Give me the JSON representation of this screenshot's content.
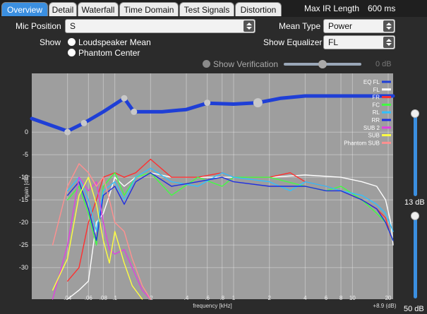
{
  "tabs": [
    {
      "label": "Overview",
      "active": true
    },
    {
      "label": "Detail"
    },
    {
      "label": "Waterfall"
    },
    {
      "label": "Time Domain"
    },
    {
      "label": "Test Signals"
    },
    {
      "label": "Distortion"
    }
  ],
  "max_ir": {
    "label": "Max IR Length",
    "value": "600 ms"
  },
  "mic_position": {
    "label": "Mic Position",
    "value": "S"
  },
  "show": {
    "label": "Show",
    "options": [
      "Loudspeaker Mean",
      "Phantom Center"
    ]
  },
  "mean_type": {
    "label": "Mean Type",
    "value": "Power"
  },
  "show_equalizer": {
    "label": "Show Equalizer",
    "value": "FL"
  },
  "verification": {
    "label": "Show Verification",
    "value": "0 dB",
    "level": 0.5
  },
  "sliders": {
    "upper": "13 dB",
    "lower": "50 dB"
  },
  "chart_data": {
    "type": "line",
    "title": "",
    "xlabel": "frequency [kHz]",
    "ylabel": "gain [dB]",
    "x_scale": "log",
    "xlim": [
      0.02,
      22
    ],
    "ylim": [
      -37,
      13
    ],
    "x_ticks": [
      {
        "v": 0.04,
        "label": ".04"
      },
      {
        "v": 0.06,
        "label": ".06"
      },
      {
        "v": 0.08,
        "label": ".08"
      },
      {
        "v": 0.1,
        "label": ".1"
      },
      {
        "v": 0.2,
        "label": ".2"
      },
      {
        "v": 0.4,
        "label": ".4"
      },
      {
        "v": 0.6,
        "label": ".6"
      },
      {
        "v": 0.8,
        "label": ".8"
      },
      {
        "v": 1,
        "label": "1"
      },
      {
        "v": 2,
        "label": "2"
      },
      {
        "v": 4,
        "label": "4"
      },
      {
        "v": 6,
        "label": "6"
      },
      {
        "v": 8,
        "label": "8"
      },
      {
        "v": 10,
        "label": "10"
      },
      {
        "v": 20,
        "label": "20"
      }
    ],
    "x_corner_label": "+8.9 (dB)",
    "y_ticks": [
      0,
      -5,
      -10,
      -15,
      -20,
      -25,
      -30
    ],
    "legend_placement": "top-right",
    "eq_points": [
      {
        "f": 0.04,
        "db": 0,
        "big": false
      },
      {
        "f": 0.055,
        "db": 2,
        "big": false
      },
      {
        "f": 0.12,
        "db": 7.5,
        "big": false
      },
      {
        "f": 0.145,
        "db": 4.5,
        "big": false
      },
      {
        "f": 0.6,
        "db": 6.5,
        "big": false
      },
      {
        "f": 1.6,
        "db": 6.5,
        "big": true
      }
    ],
    "series": [
      {
        "name": "EQ FL",
        "color": "#1f3fd6",
        "points": [
          [
            0.02,
            3
          ],
          [
            0.04,
            0.2
          ],
          [
            0.055,
            2
          ],
          [
            0.08,
            4.5
          ],
          [
            0.12,
            7.5
          ],
          [
            0.145,
            4.5
          ],
          [
            0.25,
            4.5
          ],
          [
            0.4,
            5
          ],
          [
            0.6,
            6.4
          ],
          [
            1,
            6.2
          ],
          [
            1.6,
            6.5
          ],
          [
            2.5,
            7.5
          ],
          [
            4,
            8
          ],
          [
            10,
            8
          ],
          [
            22,
            8
          ]
        ]
      },
      {
        "name": "FL",
        "color": "#ffffff",
        "points": [
          [
            0.04,
            -37
          ],
          [
            0.05,
            -35
          ],
          [
            0.06,
            -33
          ],
          [
            0.07,
            -20
          ],
          [
            0.08,
            -18
          ],
          [
            0.09,
            -14
          ],
          [
            0.1,
            -10
          ],
          [
            0.12,
            -12
          ],
          [
            0.15,
            -10
          ],
          [
            0.2,
            -9
          ],
          [
            0.3,
            -10
          ],
          [
            0.5,
            -10
          ],
          [
            1,
            -10
          ],
          [
            2,
            -10
          ],
          [
            4,
            -9.5
          ],
          [
            8,
            -10
          ],
          [
            12,
            -11
          ],
          [
            16,
            -12
          ],
          [
            19,
            -15
          ],
          [
            21,
            -20
          ],
          [
            22,
            -25
          ]
        ]
      },
      {
        "name": "FR",
        "color": "#ff3030",
        "points": [
          [
            0.04,
            -33
          ],
          [
            0.05,
            -30
          ],
          [
            0.06,
            -20
          ],
          [
            0.07,
            -15
          ],
          [
            0.08,
            -10
          ],
          [
            0.1,
            -9
          ],
          [
            0.12,
            -10
          ],
          [
            0.15,
            -9
          ],
          [
            0.2,
            -6
          ],
          [
            0.3,
            -10
          ],
          [
            0.5,
            -10
          ],
          [
            0.8,
            -9
          ],
          [
            1,
            -10
          ],
          [
            2,
            -10
          ],
          [
            3,
            -9
          ],
          [
            4,
            -11
          ],
          [
            6,
            -12
          ],
          [
            8,
            -13
          ],
          [
            12,
            -15
          ],
          [
            16,
            -17
          ],
          [
            19,
            -19
          ],
          [
            21,
            -23
          ]
        ]
      },
      {
        "name": "FC",
        "color": "#40ff40",
        "points": [
          [
            0.04,
            -15
          ],
          [
            0.05,
            -12
          ],
          [
            0.06,
            -18
          ],
          [
            0.07,
            -25
          ],
          [
            0.08,
            -12
          ],
          [
            0.1,
            -9
          ],
          [
            0.12,
            -14
          ],
          [
            0.15,
            -10
          ],
          [
            0.2,
            -9
          ],
          [
            0.3,
            -14
          ],
          [
            0.5,
            -10
          ],
          [
            0.8,
            -12
          ],
          [
            1,
            -10
          ],
          [
            2,
            -10
          ],
          [
            4,
            -12
          ],
          [
            6,
            -13
          ],
          [
            8,
            -12
          ],
          [
            12,
            -15
          ],
          [
            16,
            -18
          ],
          [
            19,
            -20
          ],
          [
            22,
            -24
          ]
        ]
      },
      {
        "name": "RL",
        "color": "#30c0ff",
        "points": [
          [
            0.04,
            -13
          ],
          [
            0.05,
            -10
          ],
          [
            0.06,
            -15
          ],
          [
            0.07,
            -22
          ],
          [
            0.08,
            -13
          ],
          [
            0.1,
            -11
          ],
          [
            0.12,
            -15
          ],
          [
            0.15,
            -10
          ],
          [
            0.2,
            -8
          ],
          [
            0.3,
            -11
          ],
          [
            0.5,
            -12
          ],
          [
            0.8,
            -9
          ],
          [
            1,
            -10
          ],
          [
            2,
            -11
          ],
          [
            3,
            -13
          ],
          [
            4,
            -11
          ],
          [
            6,
            -12
          ],
          [
            8,
            -13
          ],
          [
            12,
            -14
          ],
          [
            16,
            -16
          ],
          [
            19,
            -18
          ],
          [
            22,
            -22
          ]
        ]
      },
      {
        "name": "RR",
        "color": "#1f2fe0",
        "points": [
          [
            0.04,
            -14
          ],
          [
            0.05,
            -11
          ],
          [
            0.06,
            -17
          ],
          [
            0.07,
            -24
          ],
          [
            0.08,
            -14
          ],
          [
            0.1,
            -12
          ],
          [
            0.12,
            -16
          ],
          [
            0.15,
            -11
          ],
          [
            0.2,
            -9
          ],
          [
            0.3,
            -12
          ],
          [
            0.5,
            -11
          ],
          [
            0.8,
            -10
          ],
          [
            1,
            -11
          ],
          [
            2,
            -12
          ],
          [
            4,
            -12
          ],
          [
            6,
            -13
          ],
          [
            8,
            -13
          ],
          [
            12,
            -15
          ],
          [
            16,
            -17
          ],
          [
            19,
            -20
          ],
          [
            22,
            -24
          ]
        ]
      },
      {
        "name": "SUB 2",
        "color": "#e040e0",
        "points": [
          [
            0.03,
            -37
          ],
          [
            0.04,
            -25
          ],
          [
            0.05,
            -10
          ],
          [
            0.06,
            -13
          ],
          [
            0.07,
            -11
          ],
          [
            0.08,
            -20
          ],
          [
            0.09,
            -26
          ],
          [
            0.1,
            -27
          ],
          [
            0.12,
            -26
          ],
          [
            0.14,
            -30
          ],
          [
            0.17,
            -35
          ],
          [
            0.2,
            -37
          ]
        ]
      },
      {
        "name": "SUB",
        "color": "#ffff40",
        "points": [
          [
            0.03,
            -35
          ],
          [
            0.04,
            -28
          ],
          [
            0.05,
            -14
          ],
          [
            0.06,
            -10
          ],
          [
            0.07,
            -16
          ],
          [
            0.08,
            -24
          ],
          [
            0.09,
            -29
          ],
          [
            0.1,
            -22
          ],
          [
            0.12,
            -29
          ],
          [
            0.14,
            -34
          ],
          [
            0.17,
            -37
          ]
        ]
      },
      {
        "name": "Phantom SUB",
        "color": "#ff9090",
        "points": [
          [
            0.03,
            -25
          ],
          [
            0.04,
            -12
          ],
          [
            0.05,
            -7
          ],
          [
            0.06,
            -9
          ],
          [
            0.07,
            -12
          ],
          [
            0.08,
            -10
          ],
          [
            0.09,
            -15
          ],
          [
            0.1,
            -20
          ],
          [
            0.12,
            -22
          ],
          [
            0.14,
            -28
          ],
          [
            0.17,
            -34
          ],
          [
            0.2,
            -37
          ]
        ]
      }
    ]
  }
}
